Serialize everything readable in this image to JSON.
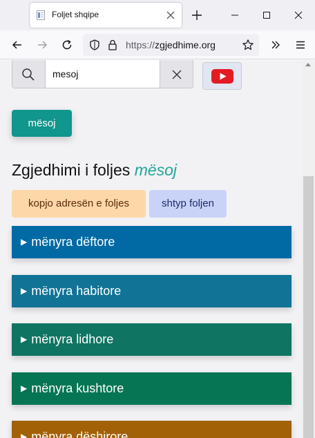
{
  "browser": {
    "tab_title": "Foljet shqipe",
    "url_scheme": "https://",
    "url_host": "zgjedhime.org"
  },
  "search": {
    "value": "mesoj"
  },
  "verb_button": "mësoj",
  "heading": {
    "prefix": "Zgjedhimi i foljes",
    "verb": "mësoj"
  },
  "actions": {
    "copy_label": "kopjo adresën e foljes",
    "print_label": "shtyp foljen"
  },
  "moods": [
    {
      "label": "mënyra dëftore",
      "color": "#016aa4"
    },
    {
      "label": "mënyra habitore",
      "color": "#117396"
    },
    {
      "label": "mënyra lidhore",
      "color": "#107462"
    },
    {
      "label": "mënyra kushtore",
      "color": "#067553"
    },
    {
      "label": "mënyra dëshirore",
      "color": "#a26107"
    }
  ],
  "colors": {
    "accent_teal": "#10968c",
    "youtube_red": "#e31b23"
  }
}
